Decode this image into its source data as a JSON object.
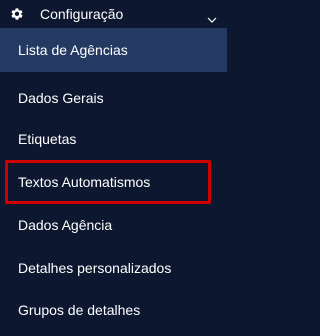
{
  "sidebar": {
    "header": {
      "label": "Configuração",
      "icon": "gear-icon",
      "chevron": "chevron-down-icon"
    },
    "items": [
      {
        "label": "Lista de Agências",
        "active": true
      },
      {
        "label": "Dados Gerais"
      },
      {
        "label": "Etiquetas"
      },
      {
        "label": "Textos Automatismos",
        "highlighted": true
      },
      {
        "label": "Dados Agência"
      },
      {
        "label": "Detalhes personalizados"
      },
      {
        "label": "Grupos de detalhes"
      }
    ]
  },
  "colors": {
    "background": "#0d1730",
    "active_background": "#243a63",
    "highlight_border": "#d00000",
    "text": "#ffffff"
  }
}
